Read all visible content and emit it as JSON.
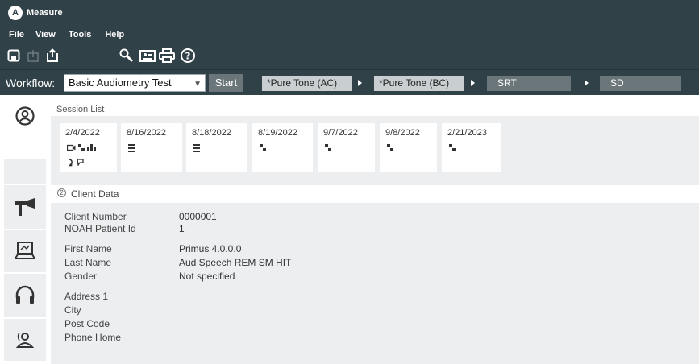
{
  "app": {
    "logo_letter": "A",
    "title": "Measure"
  },
  "menu": [
    "File",
    "View",
    "Tools",
    "Help"
  ],
  "toolbar": {
    "icons": [
      "save-icon",
      "import-icon",
      "export-icon",
      "wrench-icon",
      "card-icon",
      "print-icon",
      "help-icon"
    ]
  },
  "workflow": {
    "label": "Workflow:",
    "selected": "Basic Audiometry Test",
    "start_label": "Start",
    "steps": [
      "*Pure Tone (AC)",
      "*Pure Tone (BC)",
      "SRT",
      "SD"
    ]
  },
  "sidebar": {
    "icons": [
      "client-icon",
      "hearing-aid-icon",
      "computer-icon",
      "headphones-icon",
      "counseling-icon"
    ]
  },
  "sessions": {
    "title": "Session List",
    "items": [
      {
        "date": "2/4/2022",
        "icons": [
          "video-icon",
          "audiogram-icon",
          "bars-icon",
          "ear-icon",
          "speech-icon"
        ]
      },
      {
        "date": "8/16/2022",
        "icons": [
          "list-icon"
        ]
      },
      {
        "date": "8/18/2022",
        "icons": [
          "list-icon"
        ]
      },
      {
        "date": "8/19/2022",
        "icons": [
          "audiogram-icon"
        ]
      },
      {
        "date": "9/7/2022",
        "icons": [
          "audiogram-icon"
        ]
      },
      {
        "date": "9/8/2022",
        "icons": [
          "audiogram-icon"
        ]
      },
      {
        "date": "2/21/2023",
        "icons": [
          "audiogram-icon"
        ]
      }
    ]
  },
  "client": {
    "title": "Client Data",
    "toggle_symbol": "2",
    "fields": [
      {
        "label": "Client Number",
        "value": "0000001"
      },
      {
        "label": "NOAH Patient Id",
        "value": "1"
      },
      {
        "label": "First Name",
        "value": "Primus 4.0.0.0"
      },
      {
        "label": "Last Name",
        "value": "Aud Speech REM SM HIT"
      },
      {
        "label": "Gender",
        "value": "Not specified"
      },
      {
        "label": "Address 1",
        "value": ""
      },
      {
        "label": "City",
        "value": ""
      },
      {
        "label": "Post Code",
        "value": ""
      },
      {
        "label": "Phone Home",
        "value": ""
      }
    ]
  }
}
